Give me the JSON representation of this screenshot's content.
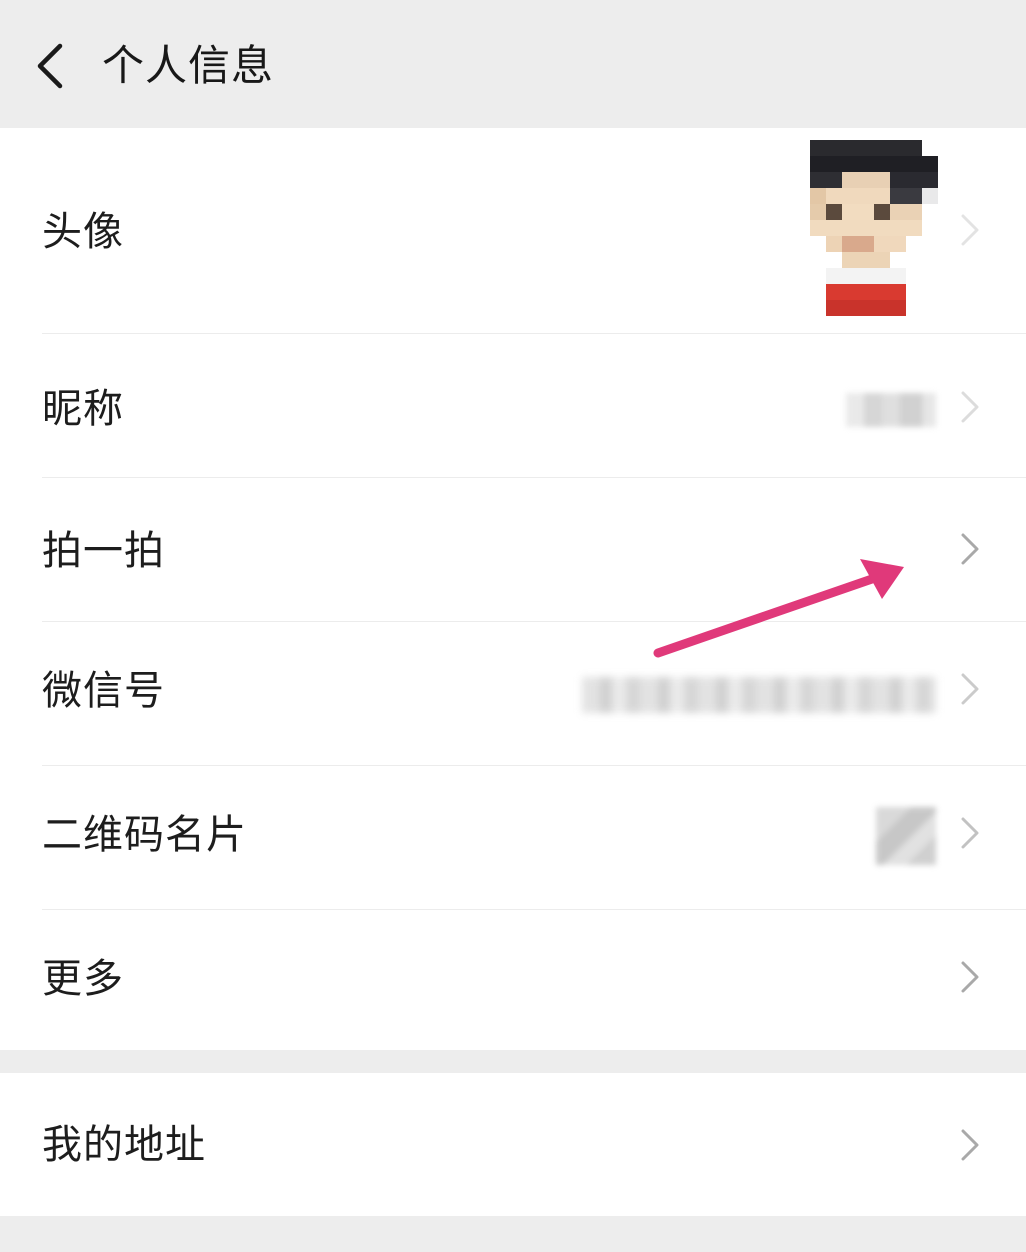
{
  "header": {
    "title": "个人信息",
    "back_icon": "chevron-left-icon"
  },
  "profile": {
    "avatar_label": "头像",
    "nickname_label": "昵称",
    "pat_label": "拍一拍",
    "wechat_id_label": "微信号",
    "qr_card_label": "二维码名片",
    "more_label": "更多"
  },
  "address": {
    "my_address_label": "我的地址"
  },
  "colors": {
    "background": "#ededed",
    "card": "#ffffff",
    "annotation_arrow": "#e0397a"
  }
}
